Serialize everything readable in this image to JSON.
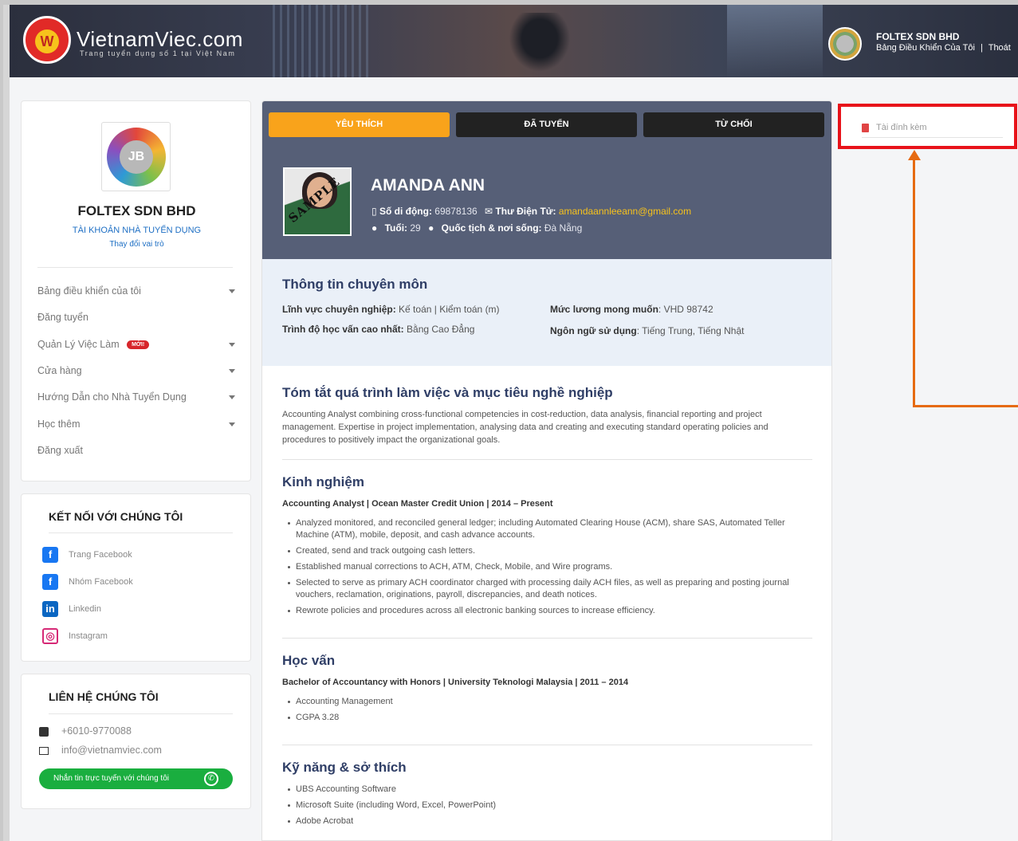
{
  "header": {
    "logo_text": "VietnamViec.com",
    "logo_tagline": "Trang tuyển dụng số 1 tại Việt Nam",
    "company": "FOLTEX SDN BHD",
    "dashboard_link": "Bảng Điều Khiển Của Tôi",
    "separator": "|",
    "logout_link": "Thoát"
  },
  "sidebar": {
    "company_name": "FOLTEX SDN BHD",
    "account_type": "TÀI KHOẢN NHÀ TUYỂN DỤNG",
    "change_role": "Thay đổi vai trò",
    "menu": [
      {
        "label": "Bảng điều khiển của tôi"
      },
      {
        "label": "Đăng tuyển"
      },
      {
        "label": "Quản Lý Việc Làm",
        "badge": "MỚI!"
      },
      {
        "label": "Cửa hàng"
      },
      {
        "label": "Hướng Dẫn cho Nhà Tuyển Dụng"
      },
      {
        "label": "Học thêm"
      },
      {
        "label": "Đăng xuất"
      }
    ],
    "connect": {
      "title": "KẾT NỐI VỚI CHÚNG TÔI",
      "links": [
        {
          "label": "Trang Facebook",
          "icon": "facebook-icon"
        },
        {
          "label": "Nhóm Facebook",
          "icon": "facebook-icon"
        },
        {
          "label": "Linkedin",
          "icon": "linkedin-icon"
        },
        {
          "label": "Instagram",
          "icon": "instagram-icon"
        }
      ]
    },
    "contact": {
      "title": "LIÊN HỆ CHÚNG TÔI",
      "phone": "+6010-9770088",
      "email": "info@vietnamviec.com",
      "chat_button": "Nhắn tin trực tuyến với chúng tôi"
    }
  },
  "tabs": [
    "YÊU THÍCH",
    "ĐÃ TUYỂN",
    "TỪ CHỐI"
  ],
  "candidate": {
    "photo_stamp": "SAMPLE",
    "name": "AMANDA ANN",
    "phone_label": "Số di động:",
    "phone": "69878136",
    "email_label": "Thư Điện Tử:",
    "email": "amandaannleeann@gmail.com",
    "age_label": "Tuổi:",
    "age": "29",
    "nationality_label": "Quốc tịch & nơi sống:",
    "nationality": "Đà Nẵng"
  },
  "professional": {
    "title": "Thông tin chuyên môn",
    "field_label": "Lĩnh vực chuyên nghiệp:",
    "field": "Kế toán | Kiểm toán (m)",
    "education_label": "Trình độ học vấn cao nhất:",
    "education": "Bằng Cao Đẳng",
    "salary_label": "Mức lương mong muốn",
    "salary": ": VHD 98742",
    "language_label": "Ngôn ngữ sử dụng",
    "language": ": Tiếng Trung, Tiếng Nhật"
  },
  "summary": {
    "title": "Tóm tắt quá trình làm việc và mục tiêu nghề nghiệp",
    "text": "Accounting Analyst combining cross-functional competencies in cost-reduction, data analysis, financial reporting and project management. Expertise in project implementation, analysing data and creating and executing standard operating policies and procedures to positively impact the organizational goals."
  },
  "experience": {
    "title": "Kinh nghiệm",
    "job": "Accounting Analyst | Ocean Master Credit Union | 2014 – Present",
    "bullets": [
      "Analyzed monitored, and reconciled general ledger; including Automated Clearing House (ACM), share SAS, Automated Teller Machine (ATM), mobile, deposit, and cash advance accounts.",
      "Created, send and track outgoing cash letters.",
      "Established manual corrections to ACH, ATM, Check, Mobile, and Wire programs.",
      "Selected to serve as primary ACH coordinator charged with processing daily ACH files, as well as preparing and posting journal vouchers, reclamation, originations, payroll, discrepancies, and death notices.",
      "Rewrote policies and procedures across all electronic banking sources to increase efficiency."
    ]
  },
  "education": {
    "title": "Học vấn",
    "degree": "Bachelor of Accountancy with Honors | University Teknologi Malaysia | 2011 – 2014",
    "bullets": [
      "Accounting Management",
      "CGPA 3.28"
    ]
  },
  "skills": {
    "title": "Kỹ năng & sở thích",
    "bullets": [
      "UBS Accounting Software",
      "Microsoft Suite (including Word, Excel, PowerPoint)",
      "Adobe Acrobat"
    ]
  },
  "attachment": {
    "label": "Tài đính kèm"
  },
  "colors": {
    "accent_orange": "#f9a31b",
    "panel_blue": "#565f77",
    "highlight_red": "#e8131a",
    "arrow_orange": "#e66b12"
  }
}
